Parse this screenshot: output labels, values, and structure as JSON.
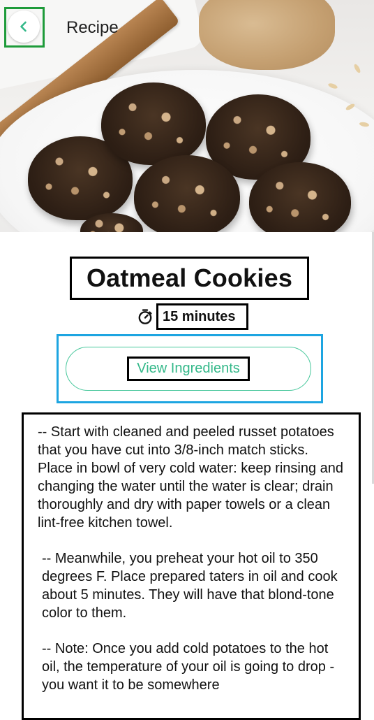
{
  "header": {
    "title": "Recipe",
    "back_icon": "chevron-left-icon"
  },
  "recipe": {
    "name": "Oatmeal Cookies",
    "time_icon": "timer-icon",
    "time": "15 minutes",
    "ingredients_button": "View Ingredients",
    "instructions": [
      "-- Start with cleaned and peeled russet potatoes that you have cut into 3/8-inch match sticks. Place in bowl of very cold water: keep rinsing and changing the water until the water is clear; drain thoroughly and dry with paper towels or a clean lint-free kitchen towel.",
      "-- Meanwhile, you preheat your hot oil to 350 degrees F. Place prepared taters in oil and cook about 5 minutes. They will have that blond-tone color to them.",
      "-- Note: Once you add cold potatoes to the hot oil, the temperature of your oil is going to drop - you want it to be somewhere"
    ]
  },
  "colors": {
    "accent": "#33b889",
    "focus_green": "#1e9b3a",
    "focus_blue": "#1da5e1"
  }
}
